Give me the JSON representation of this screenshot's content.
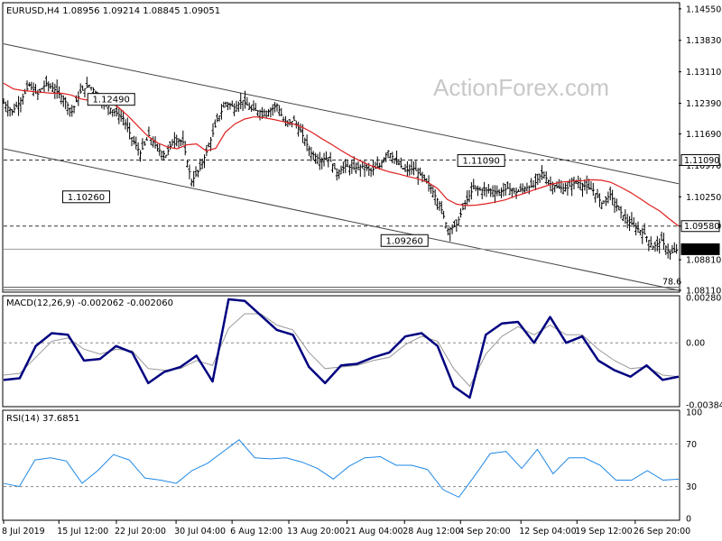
{
  "chart_data": {
    "type": "candlestick",
    "panels": {
      "price": {
        "header": "EURUSD,H4  1.08956 1.09214 1.08845 1.09051",
        "ylim": [
          1.0811,
          1.1465
        ],
        "ytick_labels": [
          "1.14550",
          "1.13830",
          "1.13110",
          "1.12390",
          "1.11690",
          "1.10970",
          "1.10250",
          "1.09580",
          "1.08810",
          "1.08110"
        ],
        "ytick_values": [
          1.1455,
          1.1383,
          1.1311,
          1.1239,
          1.1169,
          1.1097,
          1.1025,
          1.0958,
          1.0881,
          1.0811
        ],
        "price_series": [
          1.124,
          1.122,
          1.1245,
          1.128,
          1.126,
          1.1285,
          1.127,
          1.125,
          1.122,
          1.1265,
          1.128,
          1.126,
          1.1235,
          1.122,
          1.1205,
          1.116,
          1.1125,
          1.1165,
          1.1135,
          1.112,
          1.116,
          1.115,
          1.106,
          1.109,
          1.114,
          1.12,
          1.124,
          1.123,
          1.1245,
          1.1225,
          1.122,
          1.122,
          1.1235,
          1.119,
          1.12,
          1.1165,
          1.1125,
          1.111,
          1.1115,
          1.108,
          1.1095,
          1.109,
          1.1095,
          1.1085,
          1.1095,
          1.113,
          1.1105,
          1.1085,
          1.109,
          1.107,
          1.1045,
          1.101,
          1.095,
          1.096,
          1.101,
          1.1045,
          1.104,
          1.104,
          1.1035,
          1.1045,
          1.1035,
          1.1045,
          1.105,
          1.108,
          1.1055,
          1.1045,
          1.1045,
          1.106,
          1.105,
          1.104,
          1.101,
          1.103,
          1.0995,
          1.097,
          1.0955,
          1.094,
          1.091,
          1.0925,
          1.0895,
          1.0905
        ],
        "ma_series": [
          1.1285,
          1.1272,
          1.1268,
          1.1266,
          1.1264,
          1.1262,
          1.1262,
          1.1258,
          1.1249,
          1.1245,
          1.1248,
          1.1244,
          1.1228,
          1.1208,
          1.1185,
          1.1163,
          1.1148,
          1.1139,
          1.1135,
          1.1144,
          1.1146,
          1.113,
          1.1136,
          1.1173,
          1.1192,
          1.1203,
          1.1208,
          1.1206,
          1.1202,
          1.1197,
          1.1192,
          1.1184,
          1.1172,
          1.1158,
          1.1145,
          1.1131,
          1.1118,
          1.1107,
          1.1097,
          1.1089,
          1.1082,
          1.1077,
          1.1071,
          1.1066,
          1.1058,
          1.1044,
          1.1019,
          1.1008,
          1.1005,
          1.1006,
          1.1009,
          1.1013,
          1.1018,
          1.1026,
          1.1033,
          1.1041,
          1.1048,
          1.1055,
          1.1059,
          1.1061,
          1.1062,
          1.1064,
          1.1063,
          1.1058,
          1.1047,
          1.1035,
          1.1021,
          1.1006,
          1.0993,
          1.0975,
          1.0958
        ],
        "horizontal_levels": [
          {
            "value": 1.1109,
            "label": "1.11090",
            "style": "dashed"
          },
          {
            "value": 1.0958,
            "label": "1.09580",
            "style": "dashed"
          },
          {
            "value": 1.09051,
            "label": "1.09051",
            "style": "current"
          }
        ],
        "fib_line": {
          "value": 1.0818,
          "label": "78.6"
        },
        "annotations": [
          {
            "label": "1.12490",
            "x": 14.6,
            "y": 1.1249
          },
          {
            "label": "1.10260",
            "x": 11.2,
            "y": 1.1026
          },
          {
            "label": "1.09260",
            "x": 54.4,
            "y": 1.0926
          },
          {
            "label": "1.11090",
            "x": 64.8,
            "y": 1.1109
          }
        ],
        "channel_lines": [
          {
            "x": [
              0,
              91.6
            ],
            "y": [
              1.1375,
              1.1055
            ]
          },
          {
            "x": [
              0,
              91.6
            ],
            "y": [
              1.1135,
              1.0811
            ]
          }
        ],
        "watermark": "ActionForex.com"
      },
      "macd": {
        "header": "MACD(12,26,9) -0.002062 -0.002060",
        "ylim": [
          -0.003848,
          0.002808
        ],
        "ytick_labels": [
          "0.002808",
          "0.00",
          "-0.003848"
        ],
        "ytick_values": [
          0.002808,
          0.0,
          -0.003848
        ],
        "macd_series": [
          -0.0023,
          -0.0022,
          -0.0002,
          0.0006,
          0.0005,
          -0.0011,
          -0.001,
          -0.0002,
          -0.0006,
          -0.0025,
          -0.0018,
          -0.0015,
          -0.0008,
          -0.0024,
          0.0027,
          0.0026,
          0.0017,
          0.0008,
          0.0005,
          -0.0015,
          -0.0025,
          -0.0014,
          -0.0013,
          -0.0009,
          -0.0006,
          0.0004,
          0.0006,
          -0.0002,
          -0.0027,
          -0.0034,
          0.0005,
          0.0012,
          0.0013,
          0.0,
          0.0016,
          0.0,
          0.0004,
          -0.0011,
          -0.0017,
          -0.0021,
          -0.0014,
          -0.0023,
          -0.0021
        ],
        "signal_series": [
          -0.002,
          -0.0019,
          -0.0009,
          0.0001,
          0.0003,
          -0.0004,
          -0.0007,
          -0.0004,
          -0.0005,
          -0.0016,
          -0.0017,
          -0.0016,
          -0.0011,
          -0.0014,
          0.0009,
          0.0018,
          0.0018,
          0.0011,
          0.0008,
          -0.0006,
          -0.0016,
          -0.0015,
          -0.0014,
          -0.0011,
          -0.0009,
          -0.0001,
          0.0004,
          0.0001,
          -0.0016,
          -0.0027,
          -0.0007,
          0.0004,
          0.001,
          0.0005,
          0.0011,
          0.0005,
          0.0005,
          -0.0004,
          -0.0011,
          -0.0016,
          -0.0015,
          -0.002,
          -0.0021
        ]
      },
      "rsi": {
        "header": "RSI(14) 37.6851",
        "ylim": [
          0,
          100
        ],
        "ytick_labels": [
          "100",
          "70",
          "30",
          "0"
        ],
        "ytick_values": [
          100,
          70,
          30,
          0
        ],
        "levels": [
          70,
          30
        ],
        "rsi_series": [
          33,
          30,
          55,
          57,
          54,
          33,
          45,
          60,
          55,
          38,
          36,
          33,
          45,
          52,
          63,
          74,
          57,
          56,
          57,
          53,
          47,
          37,
          49,
          57,
          58,
          50,
          50,
          46,
          27,
          20,
          40,
          61,
          63,
          47,
          65,
          42,
          57,
          57,
          50,
          36,
          36,
          45,
          36,
          37
        ]
      }
    },
    "x_range": [
      0,
      91.6
    ],
    "x_tick_labels": [
      "8 Jul 2019",
      "15 Jul 12:00",
      "22 Jul 20:00",
      "30 Jul 04:00",
      "6 Aug 12:00",
      "13 Aug 20:00",
      "21 Aug 04:00",
      "28 Aug 12:00",
      "4 Sep 20:00",
      "12 Sep 04:00",
      "19 Sep 12:00",
      "26 Sep 20:00"
    ],
    "x_tick_values": [
      0,
      7.5,
      15.3,
      23.4,
      31.0,
      38.7,
      46.6,
      54.4,
      62.0,
      70.2,
      77.8,
      85.7
    ]
  }
}
